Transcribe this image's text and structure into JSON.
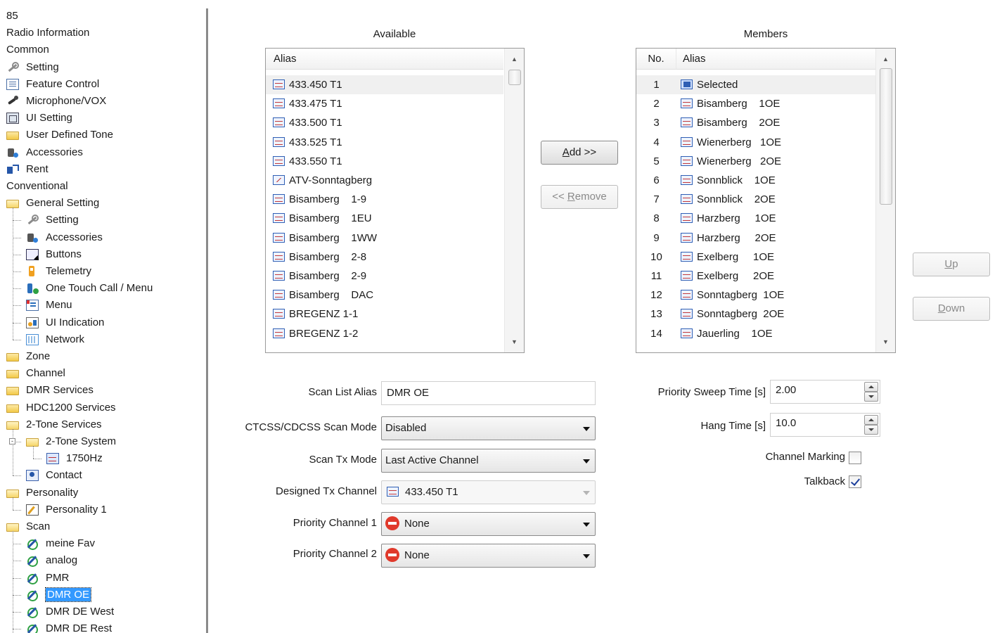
{
  "tree": {
    "items": [
      {
        "label": "85",
        "icon": "none"
      },
      {
        "label": "Radio Information",
        "icon": "none"
      },
      {
        "label": "Common",
        "icon": "none"
      },
      {
        "label": "Setting",
        "icon": "wrench-icon"
      },
      {
        "label": "Feature Control",
        "icon": "list-icon"
      },
      {
        "label": "Microphone/VOX",
        "icon": "microphone-icon"
      },
      {
        "label": "UI Setting",
        "icon": "ui-setting-icon"
      },
      {
        "label": "User Defined Tone",
        "icon": "folder-icon"
      },
      {
        "label": "Accessories",
        "icon": "accessories-icon"
      },
      {
        "label": "Rent",
        "icon": "rent-icon"
      },
      {
        "label": "Conventional",
        "icon": "none"
      },
      {
        "label": "General Setting",
        "icon": "folder-open-icon"
      },
      {
        "label": "Setting",
        "icon": "wrench-icon"
      },
      {
        "label": "Accessories",
        "icon": "accessories-icon"
      },
      {
        "label": "Buttons",
        "icon": "buttons-icon"
      },
      {
        "label": "Telemetry",
        "icon": "telemetry-icon"
      },
      {
        "label": "One Touch Call / Menu",
        "icon": "one-touch-call-icon"
      },
      {
        "label": "Menu",
        "icon": "menu-icon"
      },
      {
        "label": "UI Indication",
        "icon": "ui-indication-icon"
      },
      {
        "label": "Network",
        "icon": "network-icon"
      },
      {
        "label": "Zone",
        "icon": "folder-icon"
      },
      {
        "label": "Channel",
        "icon": "folder-icon"
      },
      {
        "label": "DMR Services",
        "icon": "folder-icon"
      },
      {
        "label": "HDC1200 Services",
        "icon": "folder-icon"
      },
      {
        "label": "2-Tone Services",
        "icon": "folder-open-icon"
      },
      {
        "label": "2-Tone System",
        "icon": "folder-open-icon"
      },
      {
        "label": "1750Hz",
        "icon": "channel-icon"
      },
      {
        "label": "Contact",
        "icon": "contact-icon"
      },
      {
        "label": "Personality",
        "icon": "folder-open-icon"
      },
      {
        "label": "Personality 1",
        "icon": "personality-icon"
      },
      {
        "label": "Scan",
        "icon": "folder-open-icon"
      },
      {
        "label": "meine Fav",
        "icon": "scan-list-icon"
      },
      {
        "label": "analog",
        "icon": "scan-list-icon"
      },
      {
        "label": "PMR",
        "icon": "scan-list-icon"
      },
      {
        "label": "DMR OE",
        "icon": "scan-list-icon"
      },
      {
        "label": "DMR DE West",
        "icon": "scan-list-icon"
      },
      {
        "label": "DMR DE Rest",
        "icon": "scan-list-icon"
      }
    ],
    "expander_minus": "-"
  },
  "available": {
    "title": "Available",
    "column": "Alias",
    "rows": [
      {
        "alias": "433.450 T1",
        "icon": "digital-channel-icon"
      },
      {
        "alias": "433.475 T1",
        "icon": "digital-channel-icon"
      },
      {
        "alias": "433.500 T1",
        "icon": "digital-channel-icon"
      },
      {
        "alias": "433.525 T1",
        "icon": "digital-channel-icon"
      },
      {
        "alias": "433.550 T1",
        "icon": "digital-channel-icon"
      },
      {
        "alias": "ATV-Sonntagberg",
        "icon": "analog-channel-icon"
      },
      {
        "alias": "Bisamberg    1-9",
        "icon": "digital-channel-icon"
      },
      {
        "alias": "Bisamberg    1EU",
        "icon": "digital-channel-icon"
      },
      {
        "alias": "Bisamberg    1WW",
        "icon": "digital-channel-icon"
      },
      {
        "alias": "Bisamberg    2-8",
        "icon": "digital-channel-icon"
      },
      {
        "alias": "Bisamberg    2-9",
        "icon": "digital-channel-icon"
      },
      {
        "alias": "Bisamberg    DAC",
        "icon": "digital-channel-icon"
      },
      {
        "alias": "BREGENZ 1-1",
        "icon": "digital-channel-icon"
      },
      {
        "alias": "BREGENZ 1-2",
        "icon": "digital-channel-icon"
      }
    ]
  },
  "members": {
    "title": "Members",
    "col_no": "No.",
    "col_alias": "Alias",
    "rows": [
      {
        "no": "1",
        "alias": "Selected",
        "icon": "selected-channel-icon"
      },
      {
        "no": "2",
        "alias": "Bisamberg    1OE",
        "icon": "digital-channel-icon"
      },
      {
        "no": "3",
        "alias": "Bisamberg    2OE",
        "icon": "digital-channel-icon"
      },
      {
        "no": "4",
        "alias": "Wienerberg   1OE",
        "icon": "digital-channel-icon"
      },
      {
        "no": "5",
        "alias": "Wienerberg   2OE",
        "icon": "digital-channel-icon"
      },
      {
        "no": "6",
        "alias": "Sonnblick    1OE",
        "icon": "digital-channel-icon"
      },
      {
        "no": "7",
        "alias": "Sonnblick    2OE",
        "icon": "digital-channel-icon"
      },
      {
        "no": "8",
        "alias": "Harzberg     1OE",
        "icon": "digital-channel-icon"
      },
      {
        "no": "9",
        "alias": "Harzberg     2OE",
        "icon": "digital-channel-icon"
      },
      {
        "no": "10",
        "alias": "Exelberg     1OE",
        "icon": "digital-channel-icon"
      },
      {
        "no": "11",
        "alias": "Exelberg     2OE",
        "icon": "digital-channel-icon"
      },
      {
        "no": "12",
        "alias": "Sonntagberg  1OE",
        "icon": "digital-channel-icon"
      },
      {
        "no": "13",
        "alias": "Sonntagberg  2OE",
        "icon": "digital-channel-icon"
      },
      {
        "no": "14",
        "alias": "Jauerling    1OE",
        "icon": "digital-channel-icon"
      }
    ]
  },
  "buttons": {
    "add_accel": "A",
    "add_rest": "dd >>",
    "remove_pre": "<< ",
    "remove_accel": "R",
    "remove_rest": "emove",
    "up_accel": "U",
    "up_rest": "p",
    "down_accel": "D",
    "down_rest": "own"
  },
  "form": {
    "scan_list_alias_label": "Scan List Alias",
    "scan_list_alias_value": "DMR OE",
    "ctcss_label": "CTCSS/CDCSS Scan Mode",
    "ctcss_value": "Disabled",
    "scan_tx_label": "Scan Tx Mode",
    "scan_tx_value": "Last Active Channel",
    "designed_tx_label": "Designed Tx Channel",
    "designed_tx_value": "433.450 T1",
    "priority1_label": "Priority Channel 1",
    "priority1_value": "None",
    "priority2_label": "Priority Channel 2",
    "priority2_value": "None",
    "sweep_label": "Priority Sweep Time [s]",
    "sweep_value": "2.00",
    "hang_label": "Hang Time [s]",
    "hang_value": "10.0",
    "channel_marking_label": "Channel Marking",
    "channel_marking_checked": false,
    "talkback_label": "Talkback",
    "talkback_checked": true
  }
}
